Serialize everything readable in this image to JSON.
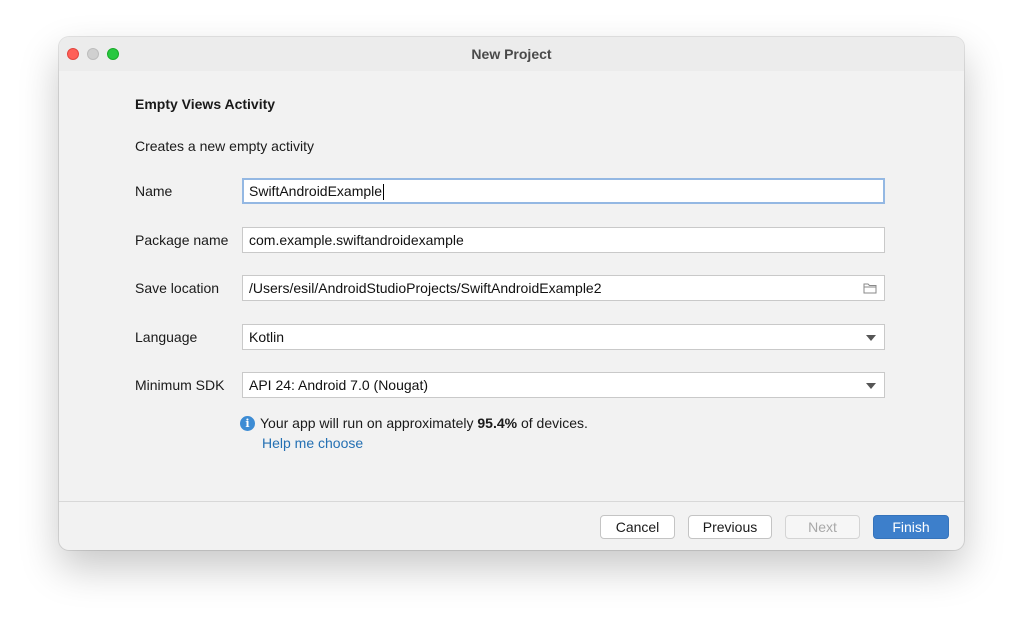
{
  "window": {
    "title": "New Project"
  },
  "template": {
    "heading": "Empty Views Activity",
    "description": "Creates a new empty activity"
  },
  "form": {
    "name": {
      "label": "Name",
      "value": "SwiftAndroidExample"
    },
    "package_name": {
      "label": "Package name",
      "value": "com.example.swiftandroidexample"
    },
    "save_location": {
      "label": "Save location",
      "value": "/Users/esil/AndroidStudioProjects/SwiftAndroidExample2"
    },
    "language": {
      "label": "Language",
      "value": "Kotlin"
    },
    "minimum_sdk": {
      "label": "Minimum SDK",
      "value": "API 24: Android 7.0 (Nougat)"
    }
  },
  "info": {
    "prefix": "Your app will run on approximately ",
    "percentage": "95.4%",
    "suffix": " of devices.",
    "help_link": "Help me choose"
  },
  "buttons": {
    "cancel": "Cancel",
    "previous": "Previous",
    "next": "Next",
    "finish": "Finish"
  },
  "colors": {
    "accent": "#3d7fcb",
    "link": "#2470b3",
    "info_icon": "#3d8cd4",
    "focus_border": "#94b8e3"
  },
  "icons": {
    "folder": "folder-icon",
    "dropdown": "chevron-down-icon",
    "info": "info-icon"
  }
}
